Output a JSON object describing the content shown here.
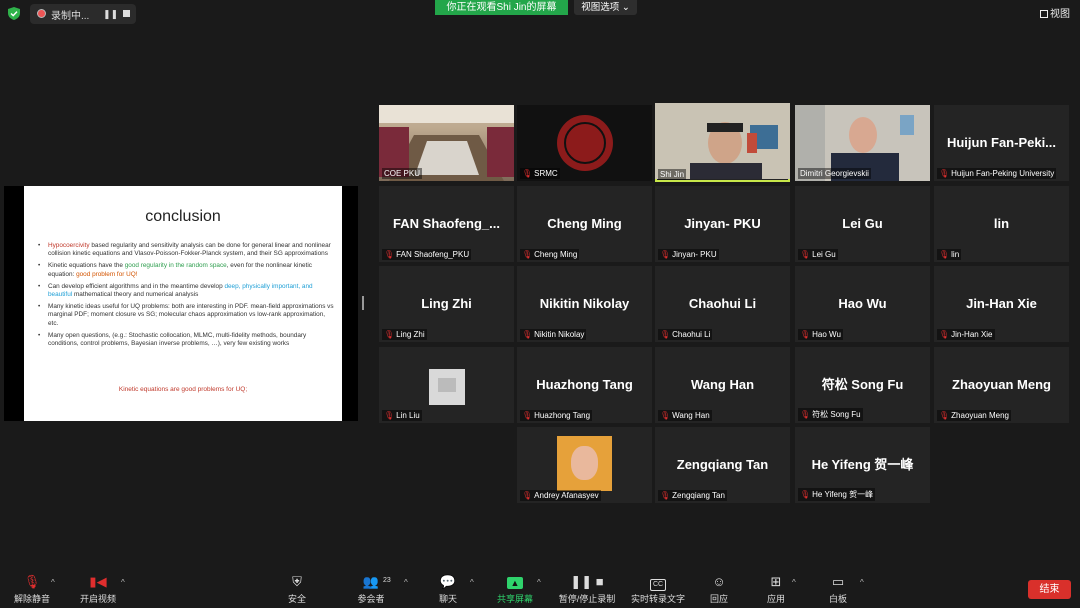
{
  "top_bar": {
    "recording_label": "录制中...",
    "viewing_banner": "你正在观看Shi Jin的屏幕",
    "view_options": "视图选项 ⌄",
    "view_button": "视图"
  },
  "shared_slide": {
    "title": "conclusion",
    "bullets": [
      {
        "prefix": "Hypocoercivity",
        "rest": " based regularity and sensitivity analysis can be done for general linear and nonlinear collision kinetic equations and Vlasov-Poisson-Fokker-Planck system,  and their SG approximations"
      },
      {
        "a": "Kinetic equations have the ",
        "b": "good regularity  in the random space",
        "c": ", even for the nonlinear  kinetic equation: ",
        "d": "good problem for UQ!"
      },
      {
        "a": "Can develop efficient algorithms and in the meantime develop ",
        "b": "deep, physically important, and beautiful",
        "c": " mathematical theory and numerical analysis"
      },
      {
        "text": "Many kinetic ideas useful for UQ problems: both are interesting in PDF.  mean-field approximations vs marginal PDF; moment closure vs SG; molecular chaos approximation vs low-rank approximation, etc."
      },
      {
        "text": "Many open questions, (e.g.: Stochastic collocation, MLMC, multi-fidelity  methods, boundary conditions, control problems, Bayesian inverse problems, …),  very few existing works"
      }
    ],
    "footer": "Kinetic equations are good problems for UQ;"
  },
  "participants": [
    {
      "label": "COE PKU",
      "muted": false,
      "video": "room"
    },
    {
      "label": "SRMC",
      "muted": true,
      "video": "logo"
    },
    {
      "label": "Shi Jin",
      "muted": false,
      "video": "person-shijin",
      "speaking": true
    },
    {
      "label": "Dimitri Georgievskii",
      "muted": false,
      "video": "person-dimitri"
    },
    {
      "label": "Huijun Fan-Peking University",
      "big": "Huijun  Fan-Peki...",
      "muted": true
    },
    {
      "label": "FAN Shaofeng_PKU",
      "big": "FAN  Shaofeng_...",
      "muted": true
    },
    {
      "label": "Cheng Ming",
      "big": "Cheng Ming",
      "muted": true
    },
    {
      "label": "Jinyan- PKU",
      "big": "Jinyan- PKU",
      "muted": true
    },
    {
      "label": "Lei Gu",
      "big": "Lei Gu",
      "muted": true
    },
    {
      "label": "lin",
      "big": "lin",
      "muted": true
    },
    {
      "label": "Ling Zhi",
      "big": "Ling Zhi",
      "muted": true
    },
    {
      "label": "Nikitin Nikolay",
      "big": "Nikitin Nikolay",
      "muted": true
    },
    {
      "label": "Chaohui Li",
      "big": "Chaohui Li",
      "muted": true
    },
    {
      "label": "Hao Wu",
      "big": "Hao Wu",
      "muted": true
    },
    {
      "label": "Jin-Han Xie",
      "big": "Jin-Han Xie",
      "muted": true
    },
    {
      "label": "Lin Liu",
      "muted": true,
      "video": "avatar"
    },
    {
      "label": "Huazhong Tang",
      "big": "Huazhong Tang",
      "muted": true
    },
    {
      "label": "Wang Han",
      "big": "Wang Han",
      "muted": true
    },
    {
      "label": "符松 Song Fu",
      "big": "符松 Song Fu",
      "muted": true
    },
    {
      "label": "Zhaoyuan Meng",
      "big": "Zhaoyuan Meng",
      "muted": true
    },
    {
      "label": "Andrey Afanasyev",
      "muted": true,
      "video": "photo"
    },
    {
      "label": "Zengqiang Tan",
      "big": "Zengqiang Tan",
      "muted": true
    },
    {
      "label": "He Yifeng 贺一峰",
      "big": "He Yifeng 贺一峰",
      "muted": true
    }
  ],
  "toolbar": {
    "unmute": "解除静音",
    "start_video": "开启视频",
    "security": "安全",
    "participants": "参会者",
    "participants_count": "23",
    "chat": "聊天",
    "share_screen": "共享屏幕",
    "pause_recording": "暂停/停止录制",
    "live_transcript": "实时转录文字",
    "reactions": "回应",
    "apps": "应用",
    "whiteboard": "白板",
    "end": "结束"
  },
  "colors": {
    "speaking_border": "#c8e84a",
    "banner_green": "#23a64a",
    "end_red": "#d9302b",
    "muted_red": "#e02e2e"
  }
}
